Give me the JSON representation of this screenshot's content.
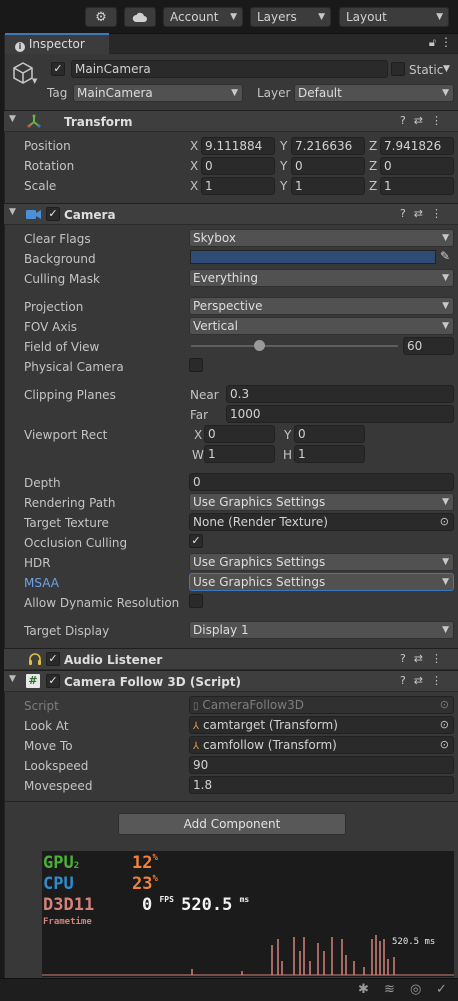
{
  "toolbar": {
    "account_label": "Account",
    "layers_label": "Layers",
    "layout_label": "Layout"
  },
  "inspector": {
    "tab_label": "Inspector",
    "object_name": "MainCamera",
    "static_label": "Static",
    "tag_label": "Tag",
    "tag_value": "MainCamera",
    "layer_label": "Layer",
    "layer_value": "Default"
  },
  "transform": {
    "title": "Transform",
    "position_label": "Position",
    "rotation_label": "Rotation",
    "scale_label": "Scale",
    "position": {
      "x": "9.111884",
      "y": "7.216636",
      "z": "7.941826"
    },
    "rotation": {
      "x": "0",
      "y": "0",
      "z": "0"
    },
    "scale": {
      "x": "1",
      "y": "1",
      "z": "1"
    },
    "x_label": "X",
    "y_label": "Y",
    "z_label": "Z"
  },
  "camera": {
    "title": "Camera",
    "clear_flags_label": "Clear Flags",
    "clear_flags_value": "Skybox",
    "background_label": "Background",
    "background_color": "#2f4c77",
    "culling_mask_label": "Culling Mask",
    "culling_mask_value": "Everything",
    "projection_label": "Projection",
    "projection_value": "Perspective",
    "fov_axis_label": "FOV Axis",
    "fov_axis_value": "Vertical",
    "field_of_view_label": "Field of View",
    "field_of_view_value": "60",
    "field_of_view_slider_fraction": 0.33,
    "physical_camera_label": "Physical Camera",
    "clipping_planes_label": "Clipping Planes",
    "near_label": "Near",
    "near_value": "0.3",
    "far_label": "Far",
    "far_value": "1000",
    "viewport_rect_label": "Viewport Rect",
    "vp_x_label": "X",
    "vp_x": "0",
    "vp_y_label": "Y",
    "vp_y": "0",
    "vp_w_label": "W",
    "vp_w": "1",
    "vp_h_label": "H",
    "vp_h": "1",
    "depth_label": "Depth",
    "depth_value": "0",
    "rendering_path_label": "Rendering Path",
    "rendering_path_value": "Use Graphics Settings",
    "target_texture_label": "Target Texture",
    "target_texture_value": "None (Render Texture)",
    "occlusion_culling_label": "Occlusion Culling",
    "hdr_label": "HDR",
    "hdr_value": "Use Graphics Settings",
    "msaa_label": "MSAA",
    "msaa_value": "Use Graphics Settings",
    "allow_dynamic_resolution_label": "Allow Dynamic Resolution",
    "target_display_label": "Target Display",
    "target_display_value": "Display 1"
  },
  "audio_listener": {
    "title": "Audio Listener"
  },
  "camera_follow": {
    "title": "Camera Follow 3D (Script)",
    "script_label": "Script",
    "script_value": "CameraFollow3D",
    "look_at_label": "Look At",
    "look_at_value": "camtarget (Transform)",
    "move_to_label": "Move To",
    "move_to_value": "camfollow (Transform)",
    "lookspeed_label": "Lookspeed",
    "lookspeed_value": "90",
    "movespeed_label": "Movespeed",
    "movespeed_value": "1.8"
  },
  "add_component_label": "Add Component",
  "stats_overlay": {
    "gpu_label": "GPU",
    "gpu_sub": "2",
    "gpu_value": "12",
    "cpu_label": "CPU",
    "cpu_value": "23",
    "percent_sign": "%",
    "api_label": "D3D11",
    "fps_value": "0",
    "fps_label": "FPS",
    "ms_value": "520.5",
    "ms_label": "ms",
    "frametime_label": "Frametime",
    "graph_label": "520.5 ms",
    "gpu_color": "#4caf3a",
    "cpu_color": "#2e8ccf",
    "api_color": "#d4827a",
    "value_color": "#f0823c"
  },
  "colors": {
    "accent": "#3a79bb",
    "msaa_label_color": "#6fa3e8"
  }
}
